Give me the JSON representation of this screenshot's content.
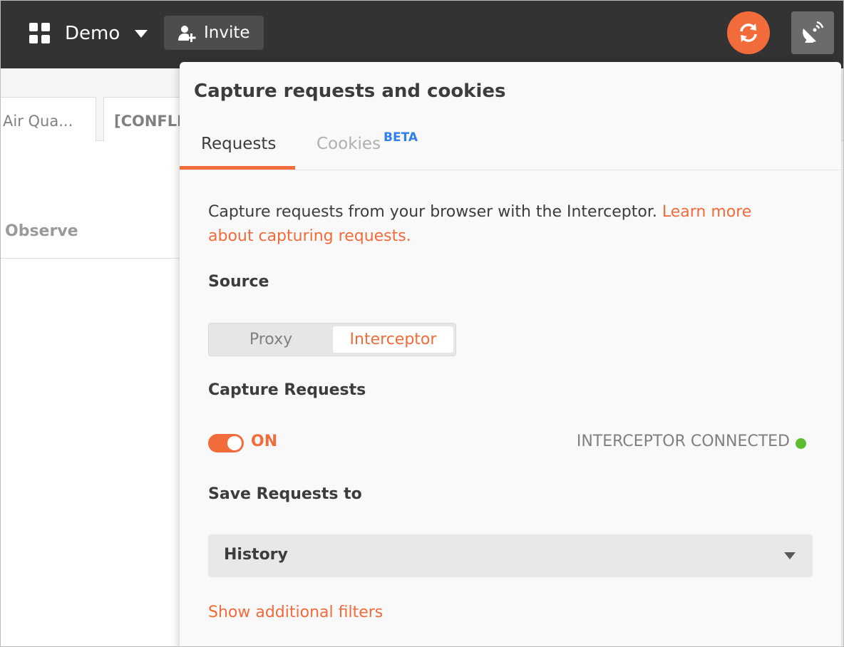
{
  "header": {
    "workspace_name": "Demo",
    "invite_label": "Invite",
    "sync_icon": "sync-icon",
    "capture_icon": "satellite-dish-icon",
    "accent_color": "#f26b3a"
  },
  "background": {
    "tabs": [
      {
        "label": "Air Qua..."
      },
      {
        "label": "[CONFLIC"
      }
    ],
    "column_header": "Observe"
  },
  "popover": {
    "title": "Capture requests and cookies",
    "tabs": [
      {
        "label": "Requests",
        "active": true
      },
      {
        "label": "Cookies",
        "badge": "BETA",
        "active": false
      }
    ],
    "description": "Capture requests from your browser with the Interceptor.",
    "learn_more_link": "Learn more about capturing requests.",
    "source": {
      "label": "Source",
      "options": [
        "Proxy",
        "Interceptor"
      ],
      "selected": "Interceptor"
    },
    "capture": {
      "label": "Capture Requests",
      "toggle_state": "ON",
      "status": "INTERCEPTOR CONNECTED",
      "status_color": "#5ebd2f"
    },
    "save": {
      "label": "Save Requests to",
      "selected": "History"
    },
    "filters_link": "Show additional filters"
  }
}
